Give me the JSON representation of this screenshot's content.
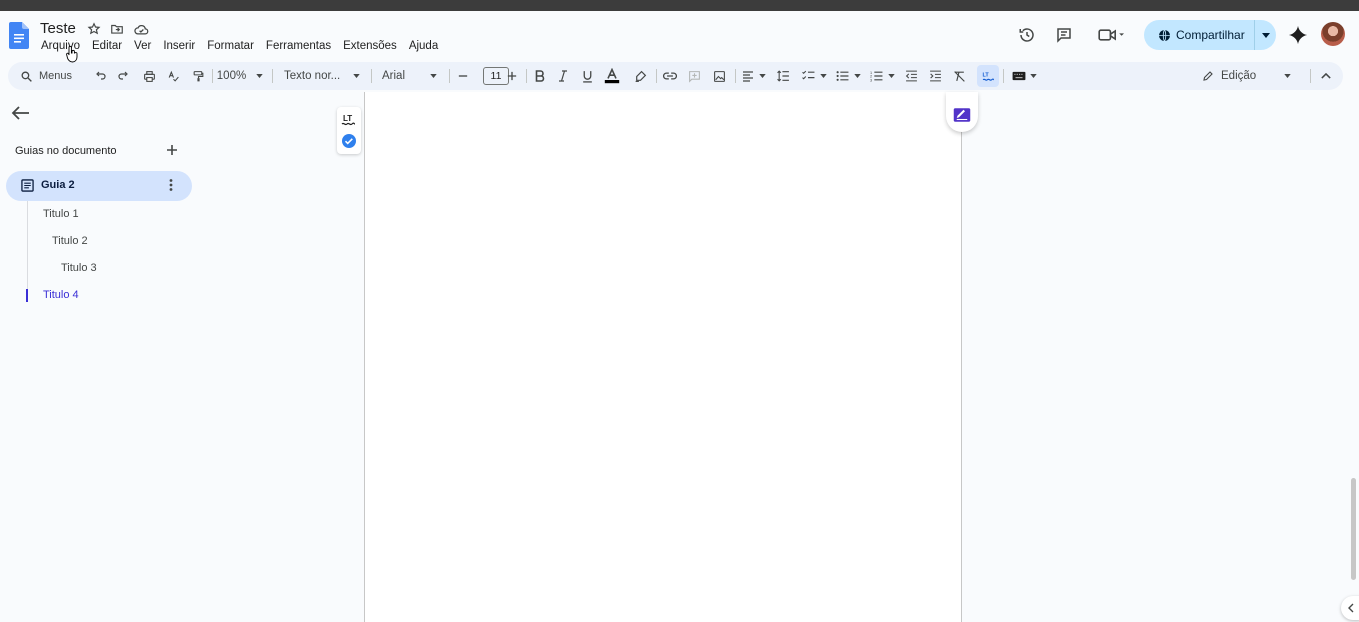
{
  "document": {
    "title": "Teste"
  },
  "menu": {
    "items": [
      "Arquivo",
      "Editar",
      "Ver",
      "Inserir",
      "Formatar",
      "Ferramentas",
      "Extensões",
      "Ajuda"
    ]
  },
  "header": {
    "share_label": "Compartilhar",
    "icons": [
      "history-icon",
      "comments-icon",
      "meet-icon",
      "gemini-icon"
    ]
  },
  "toolbar": {
    "search_menus": "Menus",
    "zoom": "100%",
    "style": "Texto nor...",
    "font": "Arial",
    "font_size": "11",
    "mode": "Edição"
  },
  "sidebar": {
    "section_title": "Guias no documento",
    "tab_label": "Guia 2",
    "headings": [
      "Titulo 1",
      "Titulo 2",
      "Titulo 3",
      "Titulo 4"
    ],
    "active_heading_color": "#3a2fd6"
  },
  "colors": {
    "accent": "#0b57d0",
    "share_bg": "#c2e7ff",
    "toolbar_bg": "#edf2fa",
    "tab_bg": "#d3e3fd"
  }
}
